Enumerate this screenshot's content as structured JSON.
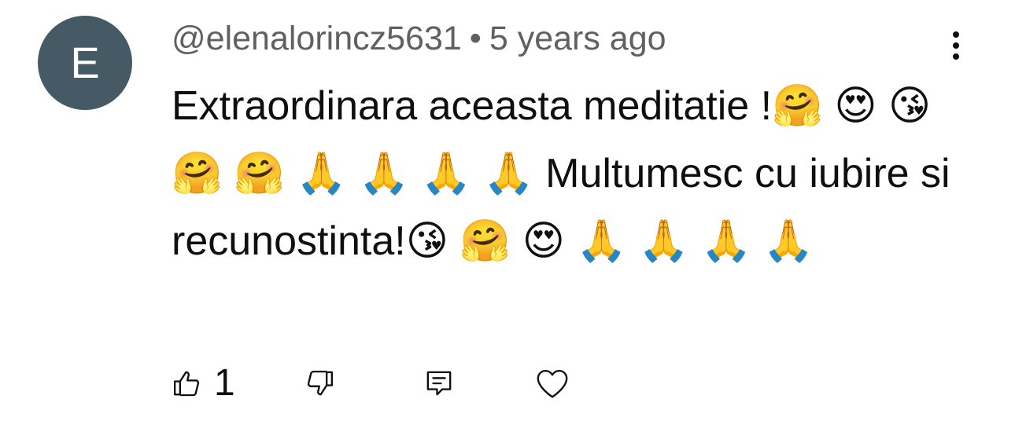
{
  "comment": {
    "avatar_letter": "E",
    "author": "@elenalorincz5631",
    "separator": "•",
    "time_ago": "5 years ago",
    "text": "Extraordinara aceasta meditatie !🤗 😍 😘 🤗 🤗 🙏 🙏 🙏 🙏 Multumesc cu iubire si recunostinta!😘 🤗 😍 🙏 🙏 🙏 🙏",
    "like_count": "1"
  },
  "colors": {
    "avatar_bg": "#455a64",
    "meta_text": "#606060",
    "body_text": "#0f0f0f"
  },
  "icons": [
    "more-vertical-icon",
    "thumbs-up-icon",
    "thumbs-down-icon",
    "reply-icon",
    "heart-icon"
  ]
}
